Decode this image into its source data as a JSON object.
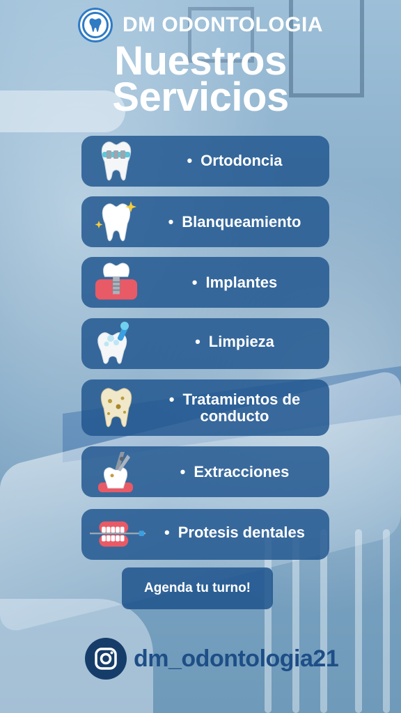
{
  "brand": {
    "name": "DM ODONTOLOGIA",
    "logo_icon": "tooth-logo-icon"
  },
  "title": {
    "line1": "Nuestros",
    "line2": "Servicios"
  },
  "services": [
    {
      "label": "Ortodoncia",
      "icon": "tooth-braces-icon"
    },
    {
      "label": "Blanqueamiento",
      "icon": "sparkling-tooth-icon"
    },
    {
      "label": "Implantes",
      "icon": "dental-implant-icon"
    },
    {
      "label": "Limpieza",
      "icon": "tooth-cleaning-icon"
    },
    {
      "label": "Tratamientos de conducto",
      "icon": "decayed-tooth-icon"
    },
    {
      "label": "Extracciones",
      "icon": "tooth-extraction-icon"
    },
    {
      "label": "Protesis dentales",
      "icon": "dentures-icon"
    }
  ],
  "bullet": "•",
  "cta": {
    "label": "Agenda tu turno!"
  },
  "social": {
    "handle": "dm_odontologia21",
    "icon": "instagram-icon"
  },
  "colors": {
    "card": "#1f548d",
    "handle": "#1d4e86",
    "accent": "#2f7bc4"
  }
}
